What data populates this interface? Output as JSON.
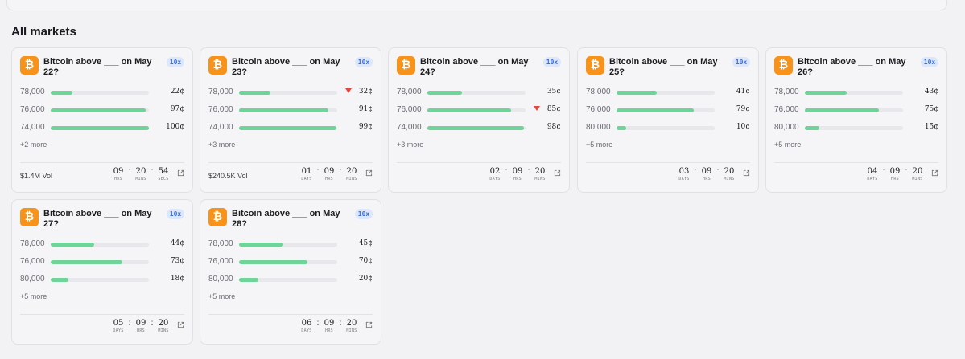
{
  "section_title": "All markets",
  "markets": [
    {
      "title": "Bitcoin above ___ on May 22?",
      "leverage": "10x",
      "rows": [
        {
          "label": "78,000",
          "price": "22¢",
          "pct": 22,
          "down": false
        },
        {
          "label": "76,000",
          "price": "97¢",
          "pct": 97,
          "down": false
        },
        {
          "label": "74,000",
          "price": "100¢",
          "pct": 100,
          "down": false
        }
      ],
      "more": "+2 more",
      "volume": "$1.4M Vol",
      "countdown": [
        {
          "value": "09",
          "unit": "HRS"
        },
        {
          "value": "20",
          "unit": "MINS"
        },
        {
          "value": "54",
          "unit": "SECS"
        }
      ]
    },
    {
      "title": "Bitcoin above ___ on May 23?",
      "leverage": "10x",
      "rows": [
        {
          "label": "78,000",
          "price": "32¢",
          "pct": 32,
          "down": true
        },
        {
          "label": "76,000",
          "price": "91¢",
          "pct": 91,
          "down": false
        },
        {
          "label": "74,000",
          "price": "99¢",
          "pct": 99,
          "down": false
        }
      ],
      "more": "+3 more",
      "volume": "$240.5K Vol",
      "countdown": [
        {
          "value": "01",
          "unit": "DAYS"
        },
        {
          "value": "09",
          "unit": "HRS"
        },
        {
          "value": "20",
          "unit": "MINS"
        }
      ]
    },
    {
      "title": "Bitcoin above ___ on May 24?",
      "leverage": "10x",
      "rows": [
        {
          "label": "78,000",
          "price": "35¢",
          "pct": 35,
          "down": false
        },
        {
          "label": "76,000",
          "price": "85¢",
          "pct": 85,
          "down": true
        },
        {
          "label": "74,000",
          "price": "98¢",
          "pct": 98,
          "down": false
        }
      ],
      "more": "+3 more",
      "volume": "",
      "countdown": [
        {
          "value": "02",
          "unit": "DAYS"
        },
        {
          "value": "09",
          "unit": "HRS"
        },
        {
          "value": "20",
          "unit": "MINS"
        }
      ]
    },
    {
      "title": "Bitcoin above ___ on May 25?",
      "leverage": "10x",
      "rows": [
        {
          "label": "78,000",
          "price": "41¢",
          "pct": 41,
          "down": false
        },
        {
          "label": "76,000",
          "price": "79¢",
          "pct": 79,
          "down": false
        },
        {
          "label": "80,000",
          "price": "10¢",
          "pct": 10,
          "down": false
        }
      ],
      "more": "+5 more",
      "volume": "",
      "countdown": [
        {
          "value": "03",
          "unit": "DAYS"
        },
        {
          "value": "09",
          "unit": "HRS"
        },
        {
          "value": "20",
          "unit": "MINS"
        }
      ]
    },
    {
      "title": "Bitcoin above ___ on May 26?",
      "leverage": "10x",
      "rows": [
        {
          "label": "78,000",
          "price": "43¢",
          "pct": 43,
          "down": false
        },
        {
          "label": "76,000",
          "price": "75¢",
          "pct": 75,
          "down": false
        },
        {
          "label": "80,000",
          "price": "15¢",
          "pct": 15,
          "down": false
        }
      ],
      "more": "+5 more",
      "volume": "",
      "countdown": [
        {
          "value": "04",
          "unit": "DAYS"
        },
        {
          "value": "09",
          "unit": "HRS"
        },
        {
          "value": "20",
          "unit": "MINS"
        }
      ]
    },
    {
      "title": "Bitcoin above ___ on May 27?",
      "leverage": "10x",
      "rows": [
        {
          "label": "78,000",
          "price": "44¢",
          "pct": 44,
          "down": false
        },
        {
          "label": "76,000",
          "price": "73¢",
          "pct": 73,
          "down": false
        },
        {
          "label": "80,000",
          "price": "18¢",
          "pct": 18,
          "down": false
        }
      ],
      "more": "+5 more",
      "volume": "",
      "countdown": [
        {
          "value": "05",
          "unit": "DAYS"
        },
        {
          "value": "09",
          "unit": "HRS"
        },
        {
          "value": "20",
          "unit": "MINS"
        }
      ]
    },
    {
      "title": "Bitcoin above ___ on May 28?",
      "leverage": "10x",
      "rows": [
        {
          "label": "78,000",
          "price": "45¢",
          "pct": 45,
          "down": false
        },
        {
          "label": "76,000",
          "price": "70¢",
          "pct": 70,
          "down": false
        },
        {
          "label": "80,000",
          "price": "20¢",
          "pct": 20,
          "down": false
        }
      ],
      "more": "+5 more",
      "volume": "",
      "countdown": [
        {
          "value": "06",
          "unit": "DAYS"
        },
        {
          "value": "09",
          "unit": "HRS"
        },
        {
          "value": "20",
          "unit": "MINS"
        }
      ]
    }
  ],
  "colors": {
    "bar_fill": "#6fd39a",
    "bar_track": "#e8e8ec",
    "down_arrow": "#e5483d",
    "bitcoin": "#f7931a",
    "badge_bg": "#dce7fb",
    "badge_text": "#3b6fd6"
  },
  "icons": {
    "logo": "bitcoin-icon",
    "trend": "down-arrow-icon",
    "external": "external-link-icon"
  }
}
